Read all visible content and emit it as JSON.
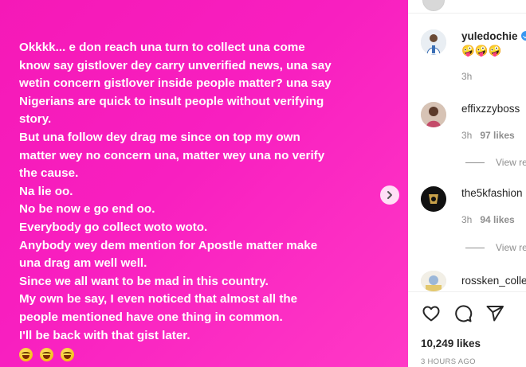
{
  "post": {
    "lines": [
      "Okkkk... e don reach una turn to collect una come",
      "know say gistlover dey carry unverified news, una say",
      "wetin concern gistlover inside people matter? una say",
      "Nigerians are quick to insult people without verifying",
      "story.",
      "But una follow dey drag me since on top my own",
      "matter wey no concern una, matter wey una no verify",
      "the cause.",
      "Na lie oo.",
      "No be now e go end oo.",
      "Everybody go collect woto woto.",
      "Anybody wey dem mention for Apostle matter make",
      "una drag am well well.",
      "Since we all want to be mad in this country.",
      "My own be say, I even noticed that almost all the",
      "people mentioned have one thing in common.",
      "I'll be back with that gist later."
    ],
    "emoji_row": "🤪🤪🤪",
    "background_color": "#f81fc0",
    "next_icon": "chevron-right-icon"
  },
  "comments": [
    {
      "username": "yuledochie",
      "verified": true,
      "text": "🤪🤪🤪",
      "time": "3h"
    },
    {
      "username": "effixzzyboss",
      "time": "3h",
      "likes": "97 likes",
      "view_replies": "View re"
    },
    {
      "username": "the5kfashion",
      "time": "3h",
      "likes": "94 likes",
      "view_replies": "View re"
    },
    {
      "username": "rossken_colle"
    }
  ],
  "actions": {
    "like_icon": "heart-icon",
    "comment_icon": "comment-icon",
    "share_icon": "share-icon"
  },
  "likes_count": "10,249 likes",
  "time_ago": "3 HOURS AGO"
}
